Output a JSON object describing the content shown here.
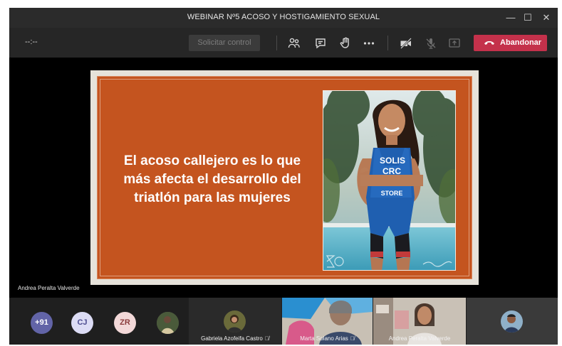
{
  "window": {
    "title": "WEBINAR Nº5 ACOSO Y HOSTIGAMIENTO SEXUAL",
    "minimize_glyph": "—",
    "maximize_glyph": "☐",
    "close_glyph": "✕"
  },
  "toolbar": {
    "timer": "--:--",
    "request_control_label": "Solicitar control",
    "leave_label": "Abandonar",
    "leave_color": "#c4314b",
    "icons": [
      "participants-icon",
      "chat-icon",
      "raise-hand-icon",
      "more-options-icon",
      "camera-off-icon",
      "mic-off-icon",
      "share-screen-icon",
      "hang-up-icon"
    ]
  },
  "shared_content": {
    "slide_quote": "El acoso callejero es lo que más afecta el desarrollo del triatlón para las mujeres",
    "slide_color": "#c4541f",
    "jersey_text_1": "SOLIS",
    "jersey_text_2": "CRC",
    "jersey_text_3": "STORE",
    "presenter_name": "Andrea Peralta Valverde"
  },
  "participants": {
    "overflow": "+91",
    "avatars": [
      {
        "initials": "CJ",
        "color": "#dcdcf5"
      },
      {
        "initials": "ZR",
        "color": "#f2d8d8"
      }
    ],
    "tiles": [
      {
        "name": "Gabriela Azofeifa Castro",
        "muted": true
      },
      {
        "name": "Marta Solano Arias",
        "muted": true
      },
      {
        "name": "Andrea Peralta Valverde",
        "muted": false
      }
    ]
  }
}
